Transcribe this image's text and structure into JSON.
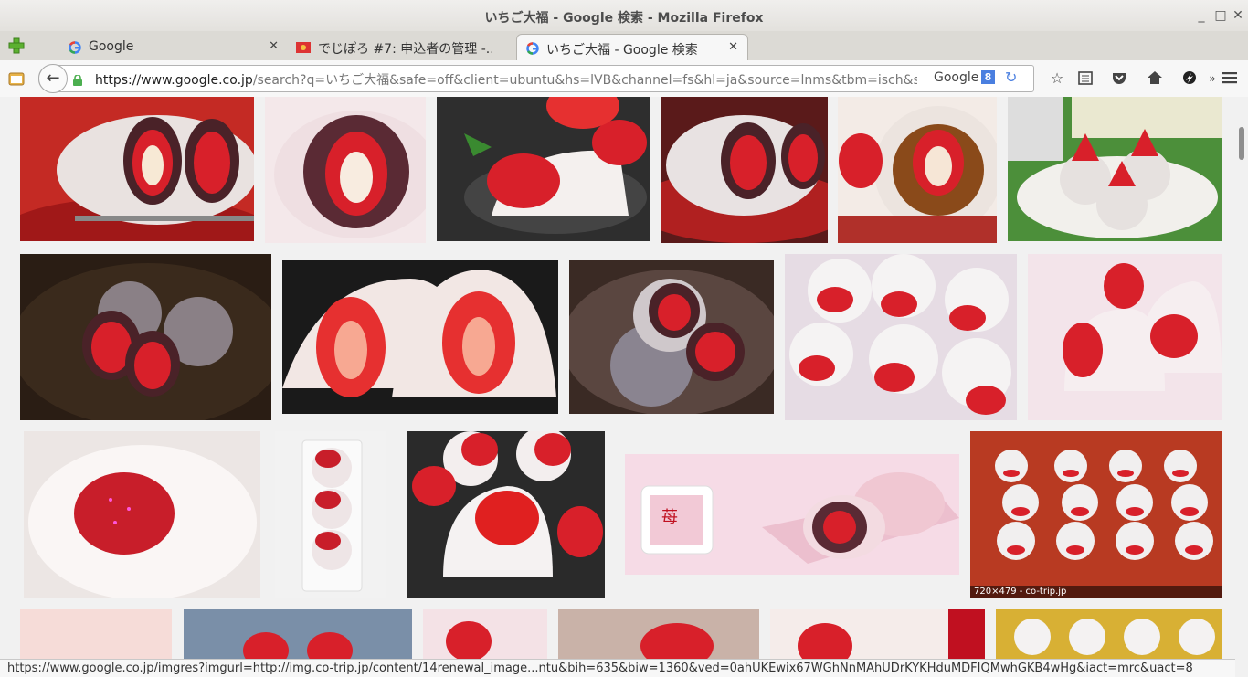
{
  "window": {
    "title": "いちご大福 - Google 検索 - Mozilla Firefox"
  },
  "tabs": [
    {
      "label": "Google",
      "favicon": "google-favicon",
      "active": false
    },
    {
      "label": "でじぽろ #7: 申込者の管理 -...",
      "favicon": "flag-favicon",
      "active": false
    },
    {
      "label": "いちご大福 - Google 検索",
      "favicon": "google-favicon",
      "active": true
    }
  ],
  "navbar": {
    "url_host": "https://www.google.co.jp",
    "url_path": "/search?q=いちご大福&safe=off&client=ubuntu&hs=lVB&channel=fs&hl=ja&source=lnms&tbm=isch&sa=X&ve",
    "search_engine": "Google",
    "search_badge": "8"
  },
  "results": {
    "hover_caption": "720×479 - co-trip.jp"
  },
  "status": {
    "link": "https://www.google.co.jp/imgres?imgurl=http://img.co-trip.jp/content/14renewal_image...ntu&bih=635&biw=1360&ved=0ahUKEwix67WGhNnMAhUDrKYKHduMDFIQMwhGKB4wHg&iact=mrc&uact=8"
  },
  "colors": {
    "accent_blue": "#4a7fe0",
    "lock_green": "#4caf50",
    "strawberry_red": "#d8202a",
    "mochi_white": "#f4f0ee",
    "bean_paste": "#4a2228"
  }
}
